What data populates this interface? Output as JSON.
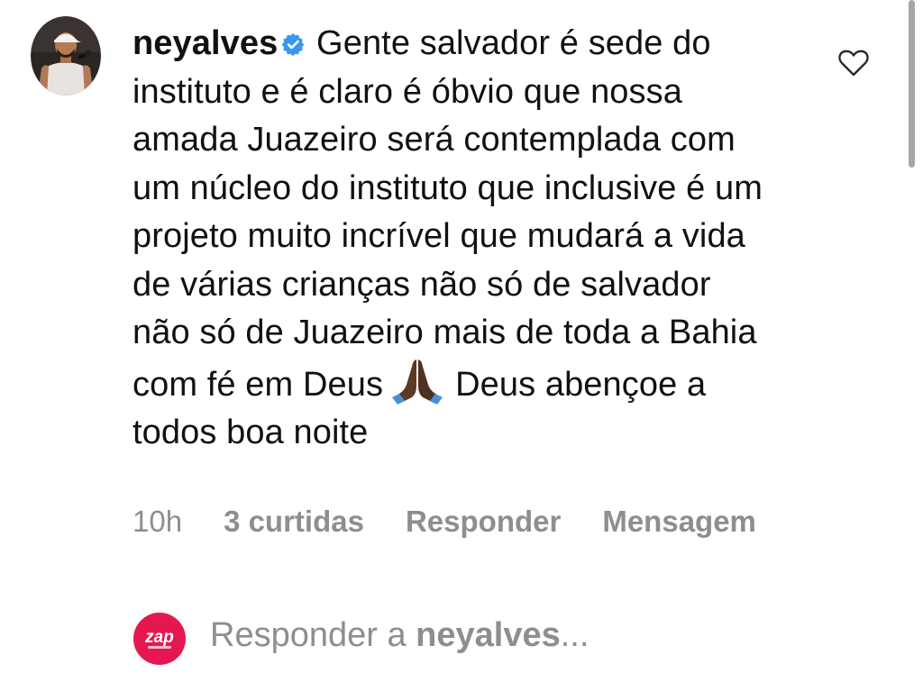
{
  "comment": {
    "username": "neyalves",
    "verified": true,
    "text_before_emoji": "Gente salvador é sede do instituto e é claro é óbvio que nossa amada Juazeiro será contemplada com um núcleo do instituto que inclusive é um projeto muito incrível que mudará a vida de várias crianças não só de salvador não só de Juazeiro mais de toda a Bahia com fé em Deus",
    "emoji": "praying-hands-dark-skin-tone",
    "text_after_emoji": "Deus abençoe a todos boa noite",
    "time": "10h",
    "likes": "3 curtidas",
    "reply_label": "Responder",
    "message_label": "Mensagem"
  },
  "reply_bar": {
    "avatar_text": "zap",
    "prefix": "Responder a",
    "target": "neyalves",
    "suffix": "..."
  },
  "colors": {
    "text": "#111111",
    "muted": "#8e8e8e",
    "verified_badge": "#3897f0",
    "zap_brand": "#e5174f"
  }
}
